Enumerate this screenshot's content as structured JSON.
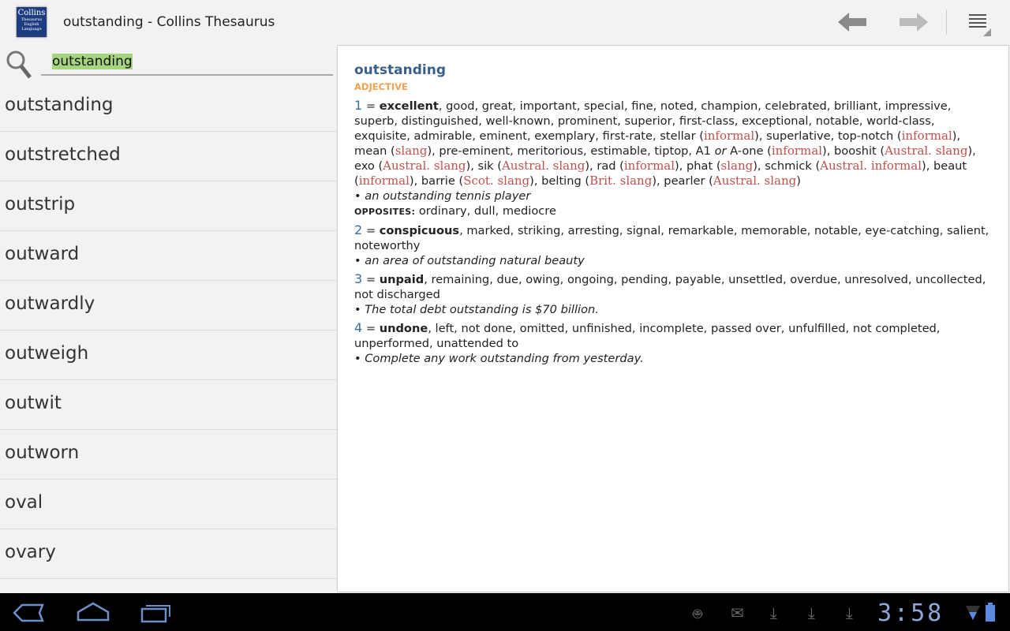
{
  "app": {
    "title": "outstanding - Collins Thesaurus",
    "logo_text": [
      "Collins",
      "Thesaurus",
      "English Language"
    ]
  },
  "search": {
    "value": "outstanding"
  },
  "word_list": [
    "outstanding",
    "outstretched",
    "outstrip",
    "outward",
    "outwardly",
    "outweigh",
    "outwit",
    "outworn",
    "oval",
    "ovary"
  ],
  "entry": {
    "headword": "outstanding",
    "pos": "ADJECTIVE",
    "senses": [
      {
        "segments": [
          [
            "n",
            "1"
          ],
          [
            "t",
            " = "
          ],
          [
            "b",
            "excellent"
          ],
          [
            "t",
            ", good, great, important, special, fine, noted, champion, celebrated, brilliant, impressive, superb, distinguished, well-known, prominent, superior, first-class, exceptional, notable, world-class, exquisite, admirable, eminent, exemplary, first-rate, stellar ("
          ],
          [
            "r",
            "informal"
          ],
          [
            "t",
            "), superlative, top-notch ("
          ],
          [
            "r",
            "informal"
          ],
          [
            "t",
            "), mean ("
          ],
          [
            "r",
            "slang"
          ],
          [
            "t",
            "), pre-eminent, meritorious, estimable, tiptop, A1 "
          ],
          [
            "i",
            "or"
          ],
          [
            "t",
            " A-one ("
          ],
          [
            "r",
            "informal"
          ],
          [
            "t",
            "), booshit ("
          ],
          [
            "r",
            "Austral. slang"
          ],
          [
            "t",
            "), exo ("
          ],
          [
            "r",
            "Austral. slang"
          ],
          [
            "t",
            "), sik ("
          ],
          [
            "r",
            "Austral. slang"
          ],
          [
            "t",
            "), rad ("
          ],
          [
            "r",
            "informal"
          ],
          [
            "t",
            "), phat ("
          ],
          [
            "r",
            "slang"
          ],
          [
            "t",
            "), schmick ("
          ],
          [
            "r",
            "Austral. informal"
          ],
          [
            "t",
            "), beaut ("
          ],
          [
            "r",
            "informal"
          ],
          [
            "t",
            "), barrie ("
          ],
          [
            "r",
            "Scot. slang"
          ],
          [
            "t",
            "), belting ("
          ],
          [
            "r",
            "Brit. slang"
          ],
          [
            "t",
            "), pearler ("
          ],
          [
            "r",
            "Austral. slang"
          ],
          [
            "t",
            ")"
          ]
        ],
        "example": "• an outstanding tennis player",
        "opposites_label": "OPPOSITES:",
        "opposites": " ordinary, dull, mediocre"
      },
      {
        "segments": [
          [
            "n",
            "2"
          ],
          [
            "t",
            " = "
          ],
          [
            "b",
            "conspicuous"
          ],
          [
            "t",
            ", marked, striking, arresting, signal, remarkable, memorable, notable, eye-catching, salient, noteworthy"
          ]
        ],
        "example": "• an area of outstanding natural beauty"
      },
      {
        "segments": [
          [
            "n",
            "3"
          ],
          [
            "t",
            " = "
          ],
          [
            "b",
            "unpaid"
          ],
          [
            "t",
            ", remaining, due, owing, ongoing, pending, payable, unsettled, overdue, unresolved, uncollected, not discharged"
          ]
        ],
        "example": "• The total debt outstanding is $70 billion."
      },
      {
        "segments": [
          [
            "n",
            "4"
          ],
          [
            "t",
            " = "
          ],
          [
            "b",
            "undone"
          ],
          [
            "t",
            ", left, not done, omitted, unfinished, incomplete, passed over, unfulfilled, not completed, unperformed, unattended to"
          ]
        ],
        "example": "• Complete any work outstanding from yesterday."
      }
    ]
  },
  "status": {
    "time": "3:58",
    "icons": [
      "android-debug-icon",
      "gmail-icon",
      "download-icon",
      "download-icon",
      "download-icon",
      "wifi-icon",
      "battery-icon"
    ]
  },
  "colors": {
    "headword": "#3a5f8a",
    "pos": "#f0a050",
    "register": "#c0504d",
    "highlight": "#a5d57f",
    "clock": "#8fa5d8"
  }
}
